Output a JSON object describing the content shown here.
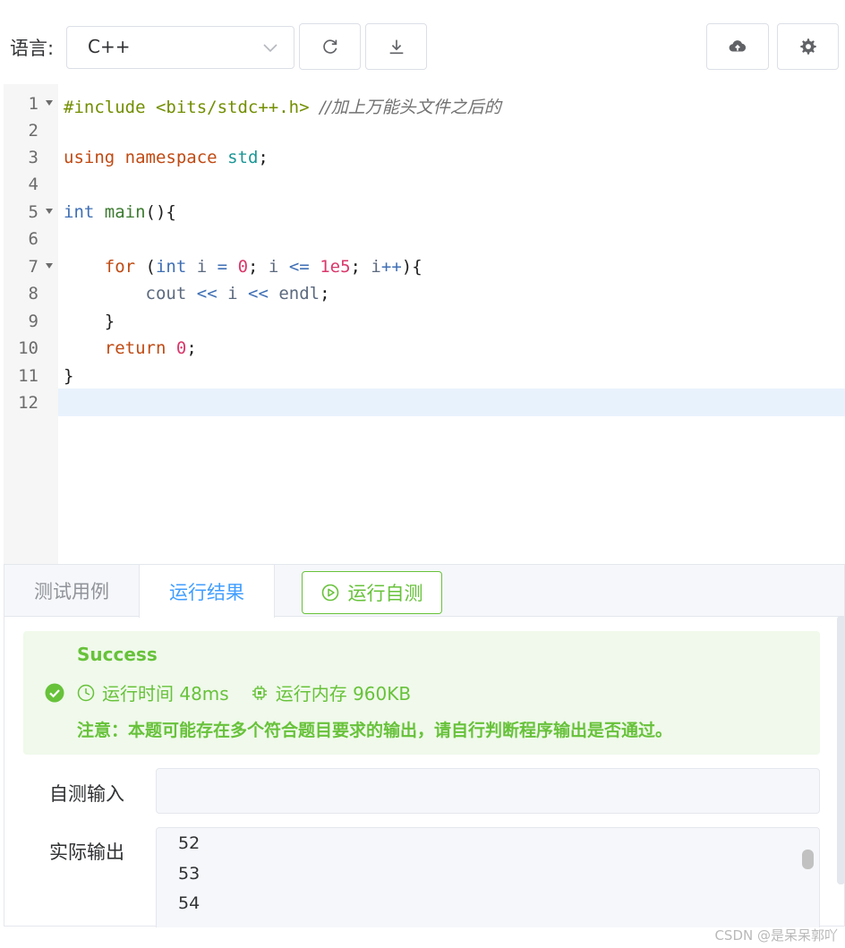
{
  "toolbar": {
    "language_label": "语言:",
    "language_value": "C++",
    "refresh_icon": "refresh-icon",
    "download_icon": "download-icon",
    "upload_icon": "cloud-upload-icon",
    "settings_icon": "gear-icon"
  },
  "editor": {
    "line_numbers": [
      "1",
      "2",
      "3",
      "4",
      "5",
      "6",
      "7",
      "8",
      "9",
      "10",
      "11",
      "12"
    ],
    "foldable_lines": [
      1,
      5,
      7
    ],
    "current_line": 12,
    "lines": [
      "#include <bits/stdc++.h> //加上万能头文件之后的",
      "",
      "using namespace std;",
      "",
      "int main(){",
      "",
      "    for (int i = 0; i <= 1e5; i++){",
      "        cout << i << endl;",
      "    }",
      "    return 0;",
      "}",
      ""
    ]
  },
  "tabs": {
    "test_cases": "测试用例",
    "run_result": "运行结果",
    "run_self_test": "运行自测"
  },
  "result": {
    "status": "Success",
    "time_label": "运行时间 48ms",
    "memory_label": "运行内存 960KB",
    "note": "注意：本题可能存在多个符合题目要求的输出，请自行判断程序输出是否通过。",
    "colors": {
      "success": "#67c23a",
      "success_bg": "#f0f9eb",
      "primary": "#409eff"
    }
  },
  "io": {
    "self_input_label": "自测输入",
    "self_input_value": "",
    "actual_output_label": "实际输出",
    "output_lines": [
      "52",
      "53",
      "54"
    ]
  },
  "watermark": "CSDN @是呆呆郭吖"
}
